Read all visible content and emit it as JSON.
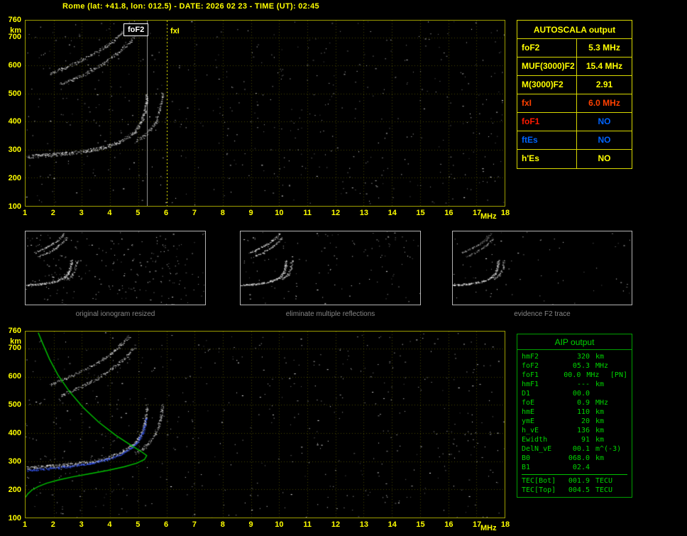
{
  "header": {
    "title": "Rome (lat: +41.8, lon: 012.5) - DATE: 2026 02 23 - TIME (UT): 02:45"
  },
  "colors": {
    "yellow": "#ffff00",
    "red": "#ff1a00",
    "orange_red": "#ff4000",
    "blue": "#0064ff",
    "green_text": "#00d400",
    "green_border": "#00a000",
    "white": "#ffffff",
    "caption_gray": "#878787",
    "plot_border": "#9c9c00"
  },
  "plot_labels": {
    "foF2": "foF2",
    "fxI": "fxI",
    "km": "km",
    "mhz": "MHz"
  },
  "autoscala_table": {
    "title": "AUTOSCALA output",
    "rows": [
      {
        "param": "foF2",
        "value": "5.3 MHz",
        "param_color": "#ffff00",
        "value_color": "#ffff00"
      },
      {
        "param": "MUF(3000)F2",
        "value": "15.4 MHz",
        "param_color": "#ffff00",
        "value_color": "#ffff00"
      },
      {
        "param": "M(3000)F2",
        "value": "2.91",
        "param_color": "#ffff00",
        "value_color": "#ffff00"
      },
      {
        "param": "fxI",
        "value": "6.0 MHz",
        "param_color": "#ff4000",
        "value_color": "#ff4000"
      },
      {
        "param": "foF1",
        "value": "NO",
        "param_color": "#ff1a00",
        "value_color": "#0064ff"
      },
      {
        "param": "ftEs",
        "value": "NO",
        "param_color": "#0064ff",
        "value_color": "#0064ff"
      },
      {
        "param": "h'Es",
        "value": "NO",
        "param_color": "#ffff00",
        "value_color": "#ffff00"
      }
    ]
  },
  "thumbnails": [
    {
      "caption": "original ionogram resized"
    },
    {
      "caption": "eliminate multiple reflections"
    },
    {
      "caption": "evidence F2 trace"
    }
  ],
  "aip_table": {
    "title": "AIP output",
    "rows": [
      {
        "name": "hmF2",
        "value": "320",
        "unit": "km",
        "extra": ""
      },
      {
        "name": "foF2",
        "value": "05.3",
        "unit": "MHz",
        "extra": ""
      },
      {
        "name": "foF1",
        "value": "00.0",
        "unit": "MHz",
        "extra": "[PN]"
      },
      {
        "name": "hmF1",
        "value": "---",
        "unit": "km",
        "extra": ""
      },
      {
        "name": "D1",
        "value": "00.0",
        "unit": "",
        "extra": ""
      },
      {
        "name": "foE",
        "value": "0.9",
        "unit": "MHz",
        "extra": ""
      },
      {
        "name": "hmE",
        "value": "110",
        "unit": "km",
        "extra": ""
      },
      {
        "name": "ymE",
        "value": "20",
        "unit": "km",
        "extra": ""
      },
      {
        "name": "h_vE",
        "value": "136",
        "unit": "km",
        "extra": ""
      },
      {
        "name": "Ewidth",
        "value": "91",
        "unit": "km",
        "extra": ""
      },
      {
        "name": "DelN_vE",
        "value": "00.1",
        "unit": "m^(-3)",
        "extra": ""
      },
      {
        "name": "B0",
        "value": "068.0",
        "unit": "km",
        "extra": ""
      },
      {
        "name": "B1",
        "value": "02.4",
        "unit": "",
        "extra": ""
      }
    ],
    "tec_rows": [
      {
        "name": "TEC[Bot]",
        "value": "001.9",
        "unit": "TECU"
      },
      {
        "name": "TEC[Top]",
        "value": "004.5",
        "unit": "TECU"
      }
    ]
  },
  "chart_data": [
    {
      "id": "top_ionogram",
      "type": "scatter",
      "title": "ionogram with AUTOSCALA scaled characteristics",
      "xlabel": "MHz",
      "ylabel": "km",
      "xlim": [
        1,
        18
      ],
      "ylim": [
        100,
        760
      ],
      "x_ticks": [
        1,
        2,
        3,
        4,
        5,
        6,
        7,
        8,
        9,
        10,
        11,
        12,
        13,
        14,
        15,
        16,
        17,
        18
      ],
      "y_ticks": [
        760,
        700,
        600,
        500,
        400,
        300,
        200,
        100
      ],
      "grid": true,
      "markers": [
        {
          "label": "foF2",
          "x": 5.3,
          "color": "#ffffff"
        },
        {
          "label": "fxI",
          "x": 6.0,
          "color": "#ffff00"
        }
      ],
      "noise_count": 520,
      "series": [
        {
          "name": "F2-trace-O-mode",
          "color": "#ededed",
          "density": 3,
          "spread": 5,
          "points": [
            [
              1.05,
              276
            ],
            [
              1.3,
              278
            ],
            [
              1.6,
              280
            ],
            [
              2.0,
              283
            ],
            [
              2.4,
              287
            ],
            [
              2.8,
              291
            ],
            [
              3.2,
              297
            ],
            [
              3.6,
              305
            ],
            [
              3.95,
              314
            ],
            [
              4.25,
              325
            ],
            [
              4.5,
              338
            ],
            [
              4.72,
              352
            ],
            [
              4.9,
              368
            ],
            [
              5.03,
              386
            ],
            [
              5.13,
              406
            ],
            [
              5.2,
              428
            ],
            [
              5.25,
              450
            ],
            [
              5.285,
              475
            ],
            [
              5.3,
              500
            ]
          ]
        },
        {
          "name": "F2-trace-X-mode",
          "color": "#e6e6e6",
          "density": 2,
          "spread": 5,
          "points": [
            [
              4.9,
              330
            ],
            [
              5.1,
              342
            ],
            [
              5.3,
              357
            ],
            [
              5.45,
              374
            ],
            [
              5.58,
              394
            ],
            [
              5.68,
              418
            ],
            [
              5.76,
              445
            ],
            [
              5.82,
              475
            ],
            [
              5.86,
              505
            ]
          ]
        },
        {
          "name": "second-hop-O-mode",
          "color": "#e6e6e6",
          "density": 2,
          "spread": 4,
          "points": [
            [
              1.85,
              570
            ],
            [
              2.2,
              585
            ],
            [
              2.6,
              602
            ],
            [
              3.0,
              621
            ],
            [
              3.4,
              642
            ],
            [
              3.75,
              663
            ],
            [
              4.05,
              684
            ],
            [
              4.3,
              705
            ],
            [
              4.5,
              725
            ],
            [
              4.68,
              745
            ]
          ]
        },
        {
          "name": "second-hop-X-mode",
          "color": "#e6e6e6",
          "density": 2,
          "spread": 4,
          "points": [
            [
              2.25,
              535
            ],
            [
              2.65,
              550
            ],
            [
              3.05,
              568
            ],
            [
              3.45,
              589
            ],
            [
              3.8,
              611
            ],
            [
              4.15,
              636
            ],
            [
              4.45,
              661
            ],
            [
              4.7,
              686
            ],
            [
              4.9,
              710
            ]
          ]
        }
      ]
    },
    {
      "id": "bottom_ionogram",
      "type": "scatter",
      "title": "ionogram with restored trace and electron density profile (AIP)",
      "xlabel": "MHz",
      "ylabel": "km",
      "xlim": [
        1,
        18
      ],
      "ylim": [
        100,
        760
      ],
      "x_ticks": [
        1,
        2,
        3,
        4,
        5,
        6,
        7,
        8,
        9,
        10,
        11,
        12,
        13,
        14,
        15,
        16,
        17,
        18
      ],
      "y_ticks": [
        760,
        700,
        600,
        500,
        400,
        300,
        200,
        100
      ],
      "grid": true,
      "noise_count": 520,
      "series": [
        {
          "name": "F2-trace-O-mode",
          "color": "#ededed",
          "density": 3,
          "spread": 5,
          "points": [
            [
              1.05,
              276
            ],
            [
              1.3,
              278
            ],
            [
              1.6,
              280
            ],
            [
              2.0,
              283
            ],
            [
              2.4,
              287
            ],
            [
              2.8,
              291
            ],
            [
              3.2,
              297
            ],
            [
              3.6,
              305
            ],
            [
              3.95,
              314
            ],
            [
              4.25,
              325
            ],
            [
              4.5,
              338
            ],
            [
              4.72,
              352
            ],
            [
              4.9,
              368
            ],
            [
              5.03,
              386
            ],
            [
              5.13,
              406
            ],
            [
              5.2,
              428
            ],
            [
              5.25,
              450
            ],
            [
              5.285,
              475
            ],
            [
              5.3,
              500
            ]
          ]
        },
        {
          "name": "F2-trace-X-mode",
          "color": "#e6e6e6",
          "density": 2,
          "spread": 5,
          "points": [
            [
              4.9,
              330
            ],
            [
              5.1,
              342
            ],
            [
              5.3,
              357
            ],
            [
              5.45,
              374
            ],
            [
              5.58,
              394
            ],
            [
              5.68,
              418
            ],
            [
              5.76,
              445
            ],
            [
              5.82,
              475
            ],
            [
              5.86,
              505
            ]
          ]
        },
        {
          "name": "second-hop-O-mode",
          "color": "#e6e6e6",
          "density": 2,
          "spread": 4,
          "points": [
            [
              1.85,
              570
            ],
            [
              2.2,
              585
            ],
            [
              2.6,
              602
            ],
            [
              3.0,
              621
            ],
            [
              3.4,
              642
            ],
            [
              3.75,
              663
            ],
            [
              4.05,
              684
            ],
            [
              4.3,
              705
            ],
            [
              4.5,
              725
            ],
            [
              4.68,
              745
            ]
          ]
        },
        {
          "name": "second-hop-X-mode",
          "color": "#e6e6e6",
          "density": 2,
          "spread": 4,
          "points": [
            [
              2.25,
              535
            ],
            [
              2.65,
              550
            ],
            [
              3.05,
              568
            ],
            [
              3.45,
              589
            ],
            [
              3.8,
              611
            ],
            [
              4.15,
              636
            ],
            [
              4.45,
              661
            ],
            [
              4.7,
              686
            ],
            [
              4.9,
              710
            ]
          ]
        },
        {
          "name": "restored-trace",
          "color": "#3a5cff",
          "density": 3,
          "spread": 3,
          "points": [
            [
              1.05,
              268
            ],
            [
              1.4,
              271
            ],
            [
              1.8,
              274
            ],
            [
              2.2,
              278
            ],
            [
              2.6,
              282
            ],
            [
              3.0,
              288
            ],
            [
              3.4,
              295
            ],
            [
              3.8,
              304
            ],
            [
              4.15,
              315
            ],
            [
              4.45,
              328
            ],
            [
              4.7,
              344
            ],
            [
              4.9,
              362
            ],
            [
              5.05,
              382
            ],
            [
              5.15,
              403
            ],
            [
              5.22,
              427
            ],
            [
              5.27,
              452
            ]
          ]
        }
      ],
      "profile": {
        "name": "electron-density-profile",
        "color": "#00c400",
        "hmF2_km": 320,
        "foF2_MHz": 5.3,
        "points": [
          [
            1.45,
            756
          ],
          [
            1.62,
            715
          ],
          [
            1.85,
            662
          ],
          [
            2.15,
            606
          ],
          [
            2.55,
            548
          ],
          [
            3.05,
            490
          ],
          [
            3.6,
            438
          ],
          [
            4.2,
            392
          ],
          [
            4.75,
            356
          ],
          [
            5.12,
            333
          ],
          [
            5.3,
            320
          ],
          [
            5.22,
            306
          ],
          [
            4.95,
            293
          ],
          [
            4.5,
            280
          ],
          [
            3.9,
            267
          ],
          [
            3.25,
            255
          ],
          [
            2.65,
            244
          ],
          [
            2.15,
            233
          ],
          [
            1.75,
            222
          ],
          [
            1.45,
            210
          ],
          [
            1.22,
            197
          ],
          [
            1.08,
            184
          ],
          [
            1.0,
            172
          ]
        ]
      }
    }
  ]
}
